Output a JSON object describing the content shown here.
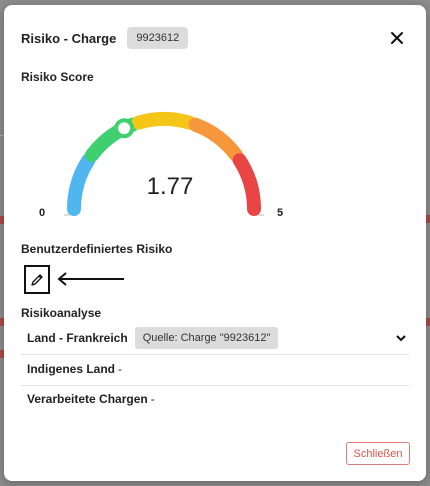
{
  "dialog": {
    "title": "Risiko - Charge",
    "charge_id": "9923612",
    "close_icon": "close-icon"
  },
  "score": {
    "heading": "Risiko Score",
    "value": "1.77",
    "min_label": "0",
    "max_label": "5",
    "value_fraction": 0.354,
    "segments": [
      "#4fb6f0",
      "#3fcf6f",
      "#f5c518",
      "#f5973a",
      "#ea4545"
    ]
  },
  "custom_risk": {
    "heading": "Benutzerdefiniertes Risiko",
    "edit_icon": "pencil-icon"
  },
  "analysis": {
    "heading": "Risikoanalyse",
    "rows": [
      {
        "label": "Land - Frankreich",
        "source": "Quelle: Charge \"9923612\"",
        "expand_icon": "chevron-down-icon"
      },
      {
        "label": "Indigenes Land",
        "suffix": "-"
      },
      {
        "label": "Verarbeitete Chargen",
        "suffix": "-"
      }
    ]
  },
  "footer": {
    "close_label": "Schließen",
    "accent_color": "#d9534f"
  }
}
